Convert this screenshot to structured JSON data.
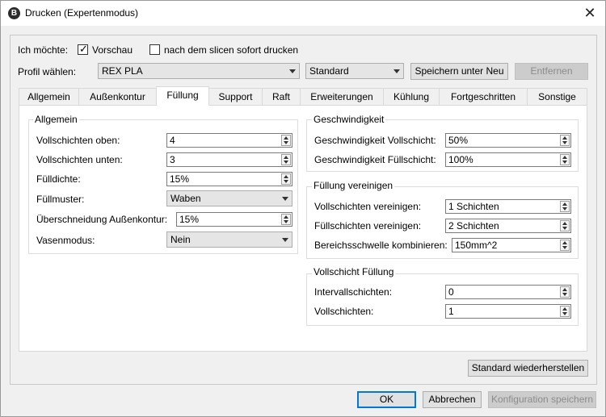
{
  "window": {
    "title": "Drucken (Expertenmodus)",
    "icon_letter": "B",
    "close_glyph": "✕"
  },
  "header": {
    "ich_moechte_label": "Ich möchte:",
    "vorschau_label": "Vorschau",
    "vorschau_checked": true,
    "sofort_label": "nach dem slicen sofort drucken",
    "sofort_checked": false,
    "profil_label": "Profil wählen:",
    "profil_value": "REX PLA",
    "standard_value": "Standard",
    "speichern_unter_label": "Speichern unter Neu",
    "entfernen_label": "Entfernen"
  },
  "tabs": [
    {
      "label": "Allgemein"
    },
    {
      "label": "Außenkontur"
    },
    {
      "label": "Füllung"
    },
    {
      "label": "Support"
    },
    {
      "label": "Raft"
    },
    {
      "label": "Erweiterungen"
    },
    {
      "label": "Kühlung"
    },
    {
      "label": "Fortgeschritten"
    },
    {
      "label": "Sonstige"
    }
  ],
  "active_tab": "Füllung",
  "allgemein": {
    "title": "Allgemein",
    "rows": [
      {
        "label": "Vollschichten oben:",
        "value": "4"
      },
      {
        "label": "Vollschichten unten:",
        "value": "3"
      },
      {
        "label": "Fülldichte:",
        "value": "15%"
      },
      {
        "label": "Füllmuster:",
        "value": "Waben"
      },
      {
        "label": "Überschneidung Außenkontur:",
        "value": "15%"
      },
      {
        "label": "Vasenmodus:",
        "value": "Nein"
      }
    ]
  },
  "geschwindigkeit": {
    "title": "Geschwindigkeit",
    "rows": [
      {
        "label": "Geschwindigkeit Vollschicht:",
        "value": "50%"
      },
      {
        "label": "Geschwindigkeit Füllschicht:",
        "value": "100%"
      }
    ]
  },
  "fuellung_vereinigen": {
    "title": "Füllung vereinigen",
    "rows": [
      {
        "label": "Vollschichten vereinigen:",
        "value": "1 Schichten"
      },
      {
        "label": "Füllschichten vereinigen:",
        "value": "2 Schichten"
      },
      {
        "label": "Bereichsschwelle kombinieren:",
        "value": "150mm^2"
      }
    ]
  },
  "vollschicht_fuellung": {
    "title": "Vollschicht Füllung",
    "rows": [
      {
        "label": "Intervallschichten:",
        "value": "0"
      },
      {
        "label": "Vollschichten:",
        "value": "1"
      }
    ]
  },
  "footer": {
    "restore_label": "Standard wiederherstellen",
    "ok_label": "OK",
    "cancel_label": "Abbrechen",
    "save_config_label": "Konfiguration speichern"
  },
  "colors": {
    "focus_accent": "#0078d7",
    "disabled_text": "#8c8c8c"
  }
}
